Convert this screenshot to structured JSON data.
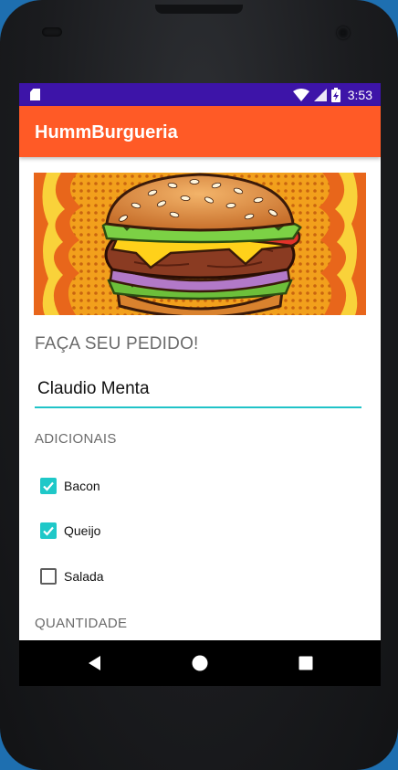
{
  "status_bar": {
    "time": "3:53",
    "icons": [
      "sd-card-icon",
      "wifi-icon",
      "signal-icon",
      "battery-charging-icon"
    ]
  },
  "app_bar": {
    "title": "HummBurgueria"
  },
  "colors": {
    "status_bar": "#3d14a8",
    "app_bar": "#ff5a26",
    "accent": "#1fc8c8"
  },
  "order_form": {
    "heading": "FAÇA SEU PEDIDO!",
    "name_value": "Claudio Menta",
    "adicionais_label": "ADICIONAIS",
    "adicionais": [
      {
        "label": "Bacon",
        "checked": true
      },
      {
        "label": "Queijo",
        "checked": true
      },
      {
        "label": "Salada",
        "checked": false
      }
    ],
    "quantidade_label": "QUANTIDADE"
  },
  "nav_bar": {
    "icons": [
      "back-icon",
      "home-icon",
      "recents-icon"
    ]
  }
}
